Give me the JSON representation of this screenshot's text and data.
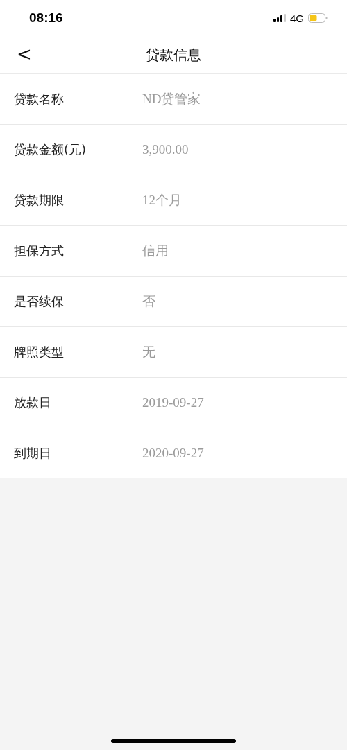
{
  "status_bar": {
    "time": "08:16",
    "network": "4G"
  },
  "nav": {
    "back": "<",
    "title": "贷款信息"
  },
  "rows": [
    {
      "label": "贷款名称",
      "value": "ND贷管家"
    },
    {
      "label": "贷款金额(元)",
      "value": "3,900.00"
    },
    {
      "label": "贷款期限",
      "value": "12个月"
    },
    {
      "label": "担保方式",
      "value": "信用"
    },
    {
      "label": "是否续保",
      "value": "否"
    },
    {
      "label": "牌照类型",
      "value": "无"
    },
    {
      "label": "放款日",
      "value": "2019-09-27"
    },
    {
      "label": "到期日",
      "value": "2020-09-27"
    }
  ]
}
